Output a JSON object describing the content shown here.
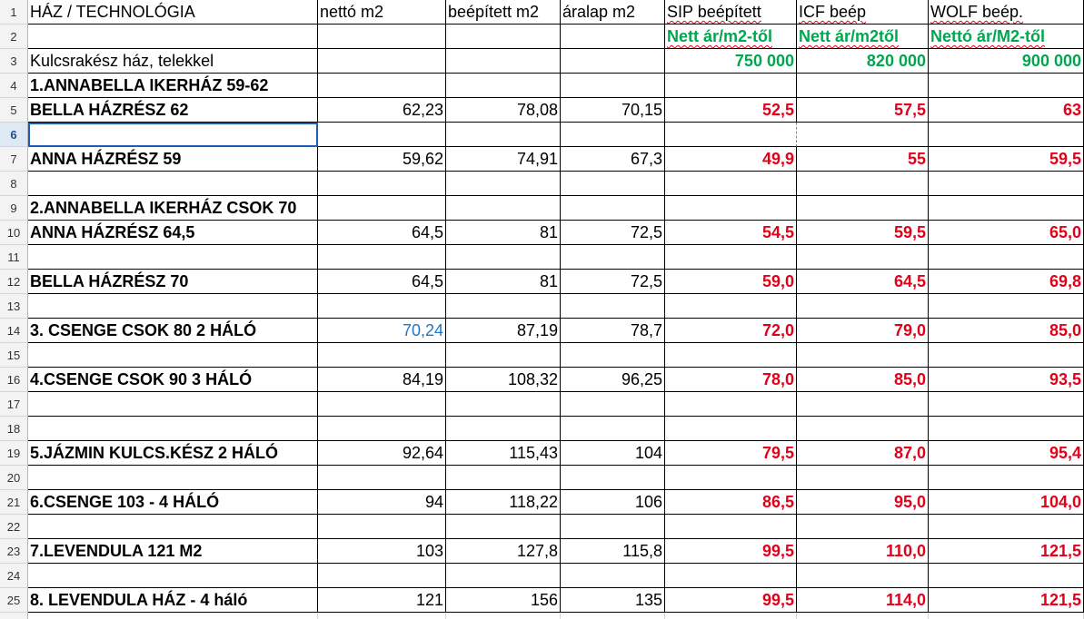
{
  "header": {
    "c1": "HÁZ / TECHNOLÓGIA",
    "c2": "nettó m2",
    "c3": "beépített m2",
    "c4": "áralap m2",
    "c5": "SIP beépített",
    "c6": "ICF beép",
    "c7": "WOLF beép."
  },
  "sub": {
    "c5": "Nett ár/m2-től",
    "c6": "Nett ár/m2től",
    "c7": "Nettó ár/M2-től"
  },
  "base": {
    "label": "Kulcsrakész ház, telekkel",
    "sip": "750 000",
    "icf": "820 000",
    "wolf": "900 000"
  },
  "rows": [
    {
      "n": "4",
      "name": "1.ANNABELLA IKERHÁZ 59-62",
      "netto": "",
      "beep": "",
      "aral": "",
      "sip": "",
      "icf": "",
      "wolf": ""
    },
    {
      "n": "5",
      "name": "BELLA HÁZRÉSZ  62",
      "netto": "62,23",
      "beep": "78,08",
      "aral": "70,15",
      "sip": "52,5",
      "icf": "57,5",
      "wolf": "63"
    },
    {
      "n": "6",
      "name": "",
      "netto": "",
      "beep": "",
      "aral": "",
      "sip": "",
      "icf": "",
      "wolf": ""
    },
    {
      "n": "7",
      "name": "ANNA HÁZRÉSZ 59",
      "netto": "59,62",
      "beep": "74,91",
      "aral": "67,3",
      "sip": "49,9",
      "icf": "55",
      "wolf": "59,5"
    },
    {
      "n": "8",
      "name": "",
      "netto": "",
      "beep": "",
      "aral": "",
      "sip": "",
      "icf": "",
      "wolf": ""
    },
    {
      "n": "9",
      "name": "2.ANNABELLA IKERHÁZ CSOK 70",
      "netto": "",
      "beep": "",
      "aral": "",
      "sip": "",
      "icf": "",
      "wolf": ""
    },
    {
      "n": "10",
      "name": "ANNA HÁZRÉSZ 64,5",
      "netto": "64,5",
      "beep": "81",
      "aral": "72,5",
      "sip": "54,5",
      "icf": "59,5",
      "wolf": "65,0"
    },
    {
      "n": "11",
      "name": "",
      "netto": "",
      "beep": "",
      "aral": "",
      "sip": "",
      "icf": "",
      "wolf": ""
    },
    {
      "n": "12",
      "name": "BELLA HÁZRÉSZ 70",
      "netto": "64,5",
      "beep": "81",
      "aral": "72,5",
      "sip": "59,0",
      "icf": "64,5",
      "wolf": "69,8"
    },
    {
      "n": "13",
      "name": "",
      "netto": "",
      "beep": "",
      "aral": "",
      "sip": "",
      "icf": "",
      "wolf": ""
    },
    {
      "n": "14",
      "name": "3. CSENGE CSOK   80 2 HÁLÓ",
      "netto": "70,24",
      "beep": "87,19",
      "aral": "78,7",
      "sip": "72,0",
      "icf": "79,0",
      "wolf": "85,0"
    },
    {
      "n": "15",
      "name": "",
      "netto": "",
      "beep": "",
      "aral": "",
      "sip": "",
      "icf": "",
      "wolf": ""
    },
    {
      "n": "16",
      "name": "4.CSENGE CSOK 90 3 HÁLÓ",
      "netto": "84,19",
      "beep": "108,32",
      "aral": "96,25",
      "sip": "78,0",
      "icf": "85,0",
      "wolf": "93,5"
    },
    {
      "n": "17",
      "name": "",
      "netto": "",
      "beep": "",
      "aral": "",
      "sip": "",
      "icf": "",
      "wolf": ""
    },
    {
      "n": "18",
      "name": "",
      "netto": "",
      "beep": "",
      "aral": "",
      "sip": "",
      "icf": "",
      "wolf": ""
    },
    {
      "n": "19",
      "name": "5.JÁZMIN KULCS.KÉSZ 2 HÁLÓ",
      "netto": "92,64",
      "beep": "115,43",
      "aral": "104",
      "sip": "79,5",
      "icf": "87,0",
      "wolf": "95,4"
    },
    {
      "n": "20",
      "name": "",
      "netto": "",
      "beep": "",
      "aral": "",
      "sip": "",
      "icf": "",
      "wolf": ""
    },
    {
      "n": "21",
      "name": "6.CSENGE 103  - 4 HÁLÓ",
      "netto": "94",
      "beep": "118,22",
      "aral": "106",
      "sip": "86,5",
      "icf": "95,0",
      "wolf": "104,0"
    },
    {
      "n": "22",
      "name": "",
      "netto": "",
      "beep": "",
      "aral": "",
      "sip": "",
      "icf": "",
      "wolf": ""
    },
    {
      "n": "23",
      "name": "7.LEVENDULA  121 M2",
      "netto": "103",
      "beep": "127,8",
      "aral": "115,8",
      "sip": "99,5",
      "icf": "110,0",
      "wolf": "121,5"
    },
    {
      "n": "24",
      "name": "",
      "netto": "",
      "beep": "",
      "aral": "",
      "sip": "",
      "icf": "",
      "wolf": ""
    },
    {
      "n": "25",
      "name": "8. LEVENDULA HÁZ - 4 háló",
      "netto": "121",
      "beep": "156",
      "aral": "135",
      "sip": "99,5",
      "icf": "114,0",
      "wolf": "121,5"
    }
  ],
  "row_numbers": [
    "1",
    "2",
    "3"
  ],
  "active_row": "6",
  "colors": {
    "price_red": "#e2001a",
    "base_green": "#00a650",
    "highlight_blue": "#1f77c8",
    "active_border": "#1a5fb4"
  }
}
